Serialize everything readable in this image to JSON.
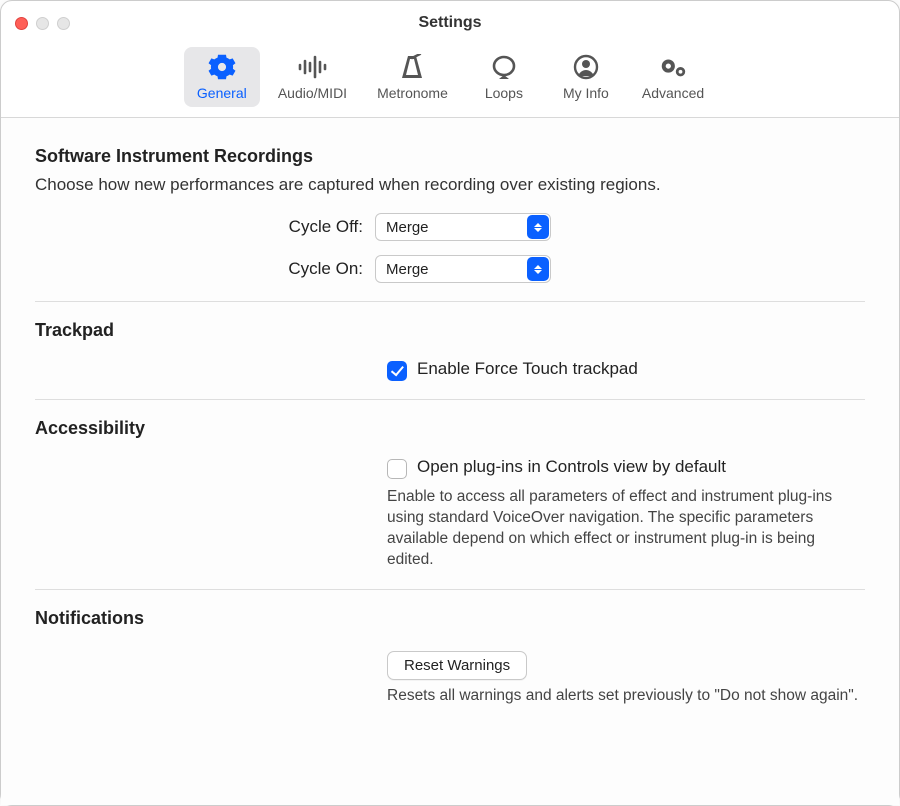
{
  "window": {
    "title": "Settings"
  },
  "tabs": [
    {
      "id": "general",
      "label": "General",
      "icon": "gear-icon",
      "active": true
    },
    {
      "id": "audiomidi",
      "label": "Audio/MIDI",
      "icon": "waveform-icon",
      "active": false
    },
    {
      "id": "metronome",
      "label": "Metronome",
      "icon": "metronome-icon",
      "active": false
    },
    {
      "id": "loops",
      "label": "Loops",
      "icon": "loop-icon",
      "active": false
    },
    {
      "id": "myinfo",
      "label": "My Info",
      "icon": "person-icon",
      "active": false
    },
    {
      "id": "advanced",
      "label": "Advanced",
      "icon": "gears-icon",
      "active": false
    }
  ],
  "sections": {
    "recordings": {
      "title": "Software Instrument Recordings",
      "desc": "Choose how new performances are captured when recording over existing regions.",
      "cycleOff": {
        "label": "Cycle Off:",
        "value": "Merge"
      },
      "cycleOn": {
        "label": "Cycle On:",
        "value": "Merge"
      }
    },
    "trackpad": {
      "title": "Trackpad",
      "forceTouch": {
        "label": "Enable Force Touch trackpad",
        "checked": true
      }
    },
    "accessibility": {
      "title": "Accessibility",
      "controlsView": {
        "label": "Open plug-ins in Controls view by default",
        "checked": false,
        "desc": "Enable to access all parameters of effect and instrument plug-ins using standard VoiceOver navigation. The specific parameters available depend on which effect or instrument plug-in is being edited."
      }
    },
    "notifications": {
      "title": "Notifications",
      "resetWarnings": {
        "button": "Reset Warnings",
        "desc": "Resets all warnings and alerts set previously to \"Do not show again\"."
      }
    }
  }
}
